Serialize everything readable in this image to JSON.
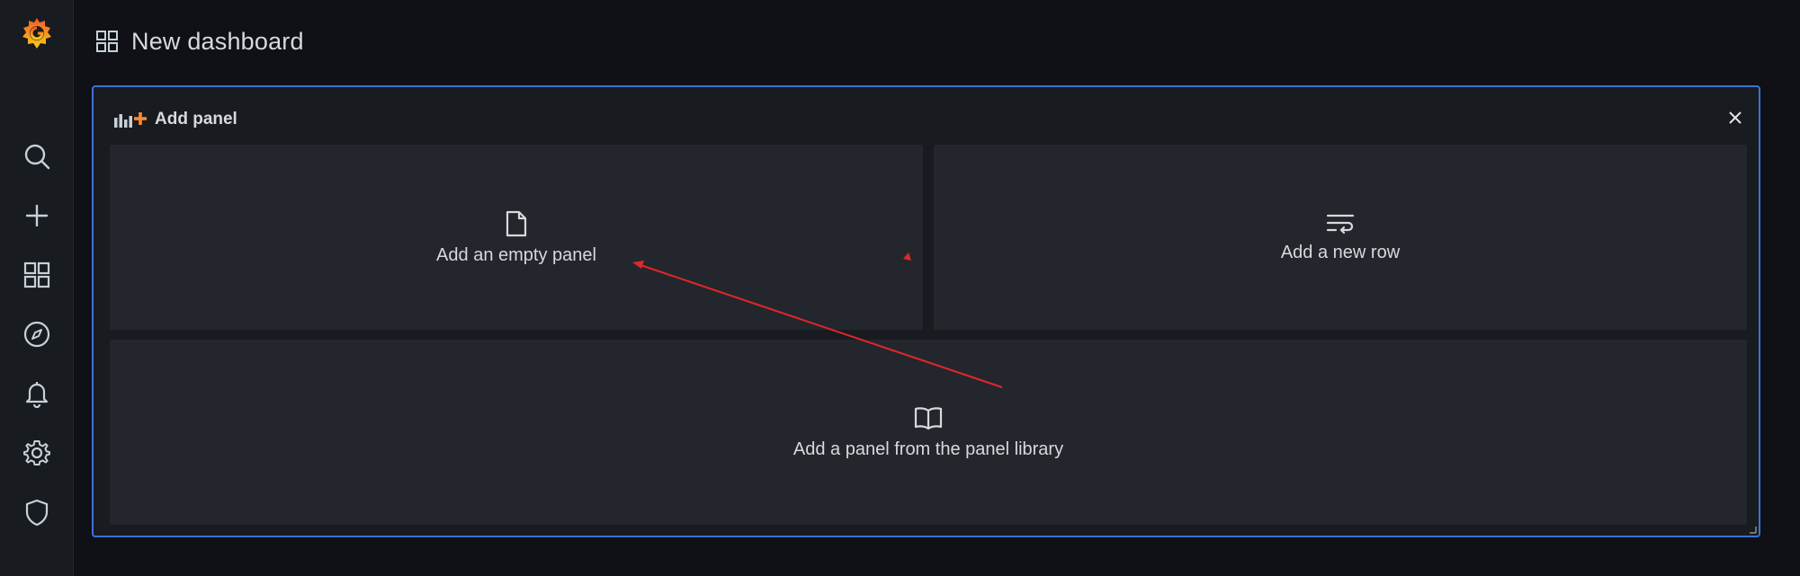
{
  "header": {
    "title": "New dashboard"
  },
  "panel": {
    "title": "Add panel",
    "options": [
      {
        "label": "Add an empty panel",
        "icon": "file-icon"
      },
      {
        "label": "Add a new row",
        "icon": "wrap-rows-icon"
      },
      {
        "label": "Add a panel from the panel library",
        "icon": "book-icon"
      }
    ]
  },
  "sidebar": {
    "items": [
      "grafana-logo",
      "search-icon",
      "plus-icon",
      "dashboards-icon",
      "explore-icon",
      "alerting-bell-icon",
      "settings-gear-icon",
      "shield-icon"
    ]
  },
  "colors": {
    "background": "#0f1117",
    "sidebar": "#181b1f",
    "panel_border": "#3d71d9",
    "option_bg": "#24262d",
    "text": "#d8d9da",
    "accent_orange": "#ff8833",
    "annotation_red": "#e02828"
  }
}
